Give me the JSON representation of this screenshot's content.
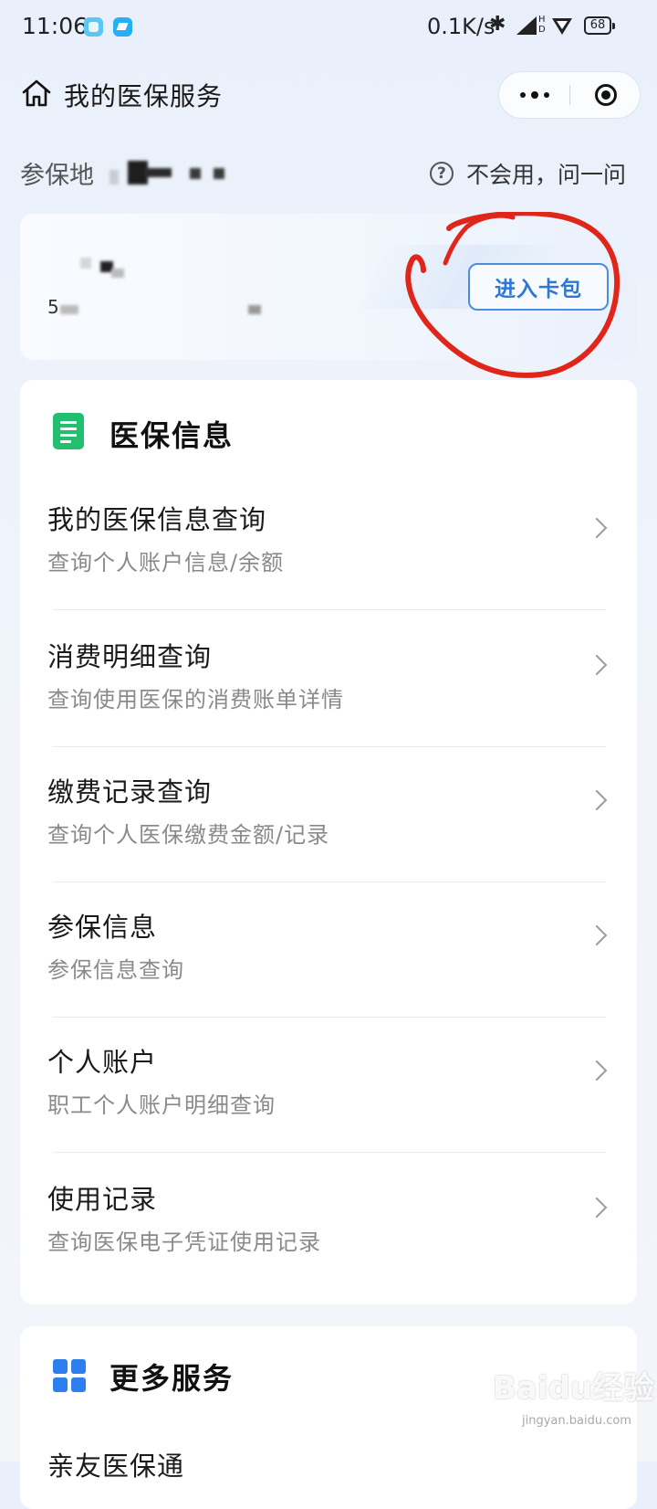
{
  "status_bar": {
    "time": "11:06",
    "network_speed": "0.1K/s",
    "battery": "68",
    "icons": [
      "app-notification-icon",
      "app-notification-icon",
      "bluetooth-icon",
      "signal-icon",
      "hd-icon",
      "wifi-icon",
      "battery-icon"
    ]
  },
  "nav": {
    "title": "我的医保服务",
    "home_icon": "home-icon",
    "more_icon": "more-dots-icon",
    "close_icon": "target-close-icon"
  },
  "region": {
    "label": "参保地",
    "help_text": "不会用，问一问",
    "help_icon": "question-circle-icon"
  },
  "card": {
    "id_prefix": "5",
    "wallet_button": "进入卡包"
  },
  "medical_info": {
    "title": "医保信息",
    "icon": "document-icon",
    "items": [
      {
        "title": "我的医保信息查询",
        "subtitle": "查询个人账户信息/余额"
      },
      {
        "title": "消费明细查询",
        "subtitle": "查询使用医保的消费账单详情"
      },
      {
        "title": "缴费记录查询",
        "subtitle": "查询个人医保缴费金额/记录"
      },
      {
        "title": "参保信息",
        "subtitle": "参保信息查询"
      },
      {
        "title": "个人账户",
        "subtitle": "职工个人账户明细查询"
      },
      {
        "title": "使用记录",
        "subtitle": "查询医保电子凭证使用记录"
      }
    ]
  },
  "more_services": {
    "title": "更多服务",
    "icon": "grid-icon",
    "first_item_partial": "亲友医保通"
  },
  "watermark": {
    "text": "Baidu经验",
    "sub": "jingyan.baidu.com"
  },
  "colors": {
    "accent_blue": "#2f78d1",
    "doc_green": "#22c06e",
    "annotation_red": "#e0251b"
  }
}
